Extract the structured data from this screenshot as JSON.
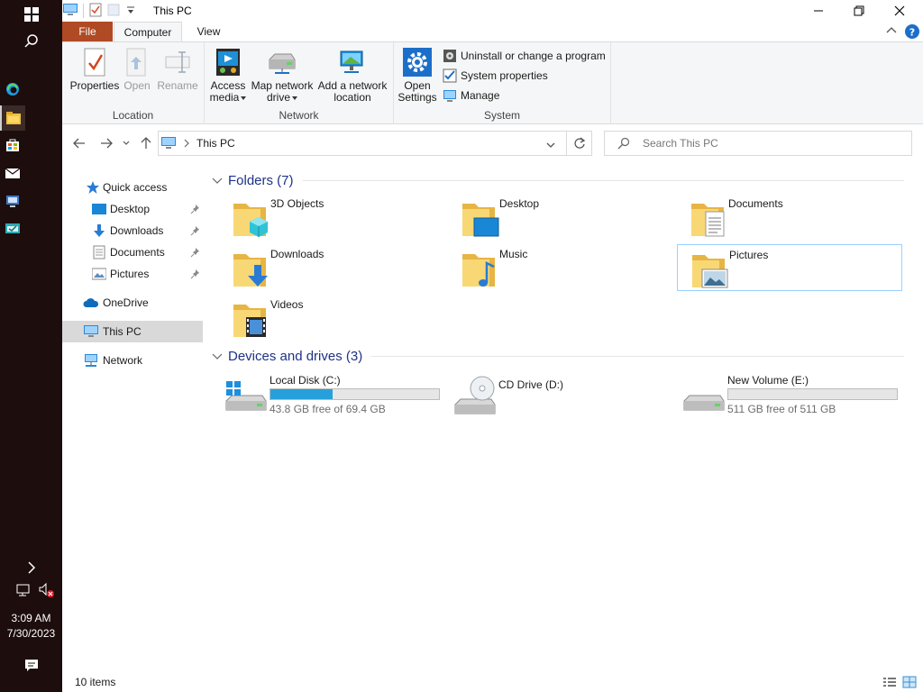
{
  "window": {
    "title": "This PC",
    "tabs": {
      "file": "File",
      "computer": "Computer",
      "view": "View"
    }
  },
  "ribbon": {
    "groups": {
      "location": "Location",
      "network": "Network",
      "system": "System"
    },
    "properties": "Properties",
    "open": "Open",
    "rename": "Rename",
    "access_media_1": "Access",
    "access_media_2": "media",
    "map_drive_1": "Map network",
    "map_drive_2": "drive",
    "add_location_1": "Add a network",
    "add_location_2": "location",
    "open_settings_1": "Open",
    "open_settings_2": "Settings",
    "uninstall": "Uninstall or change a program",
    "system_properties": "System properties",
    "manage": "Manage"
  },
  "address": {
    "path": "This PC",
    "search_placeholder": "Search This PC"
  },
  "nav": {
    "quick_access": "Quick access",
    "desktop": "Desktop",
    "downloads": "Downloads",
    "documents": "Documents",
    "pictures": "Pictures",
    "onedrive": "OneDrive",
    "this_pc": "This PC",
    "network": "Network"
  },
  "folders": {
    "header": "Folders (7)",
    "items": [
      "3D Objects",
      "Desktop",
      "Documents",
      "Downloads",
      "Music",
      "Pictures",
      "Videos"
    ]
  },
  "drives": {
    "header": "Devices and drives (3)",
    "items": [
      {
        "name": "Local Disk (C:)",
        "free": "43.8 GB free of 69.4 GB",
        "used_fraction": 0.37
      },
      {
        "name": "CD Drive (D:)"
      },
      {
        "name": "New Volume (E:)",
        "free": "511 GB free of 511 GB",
        "used_fraction": 0.0
      }
    ]
  },
  "status": {
    "items": "10 items"
  },
  "taskbar": {
    "time": "3:09 AM",
    "date": "7/30/2023"
  },
  "colors": {
    "file_tab": "#b04a24",
    "accent": "#26a0da",
    "section": "#1e3287",
    "taskbar": "#1d0d0d"
  }
}
